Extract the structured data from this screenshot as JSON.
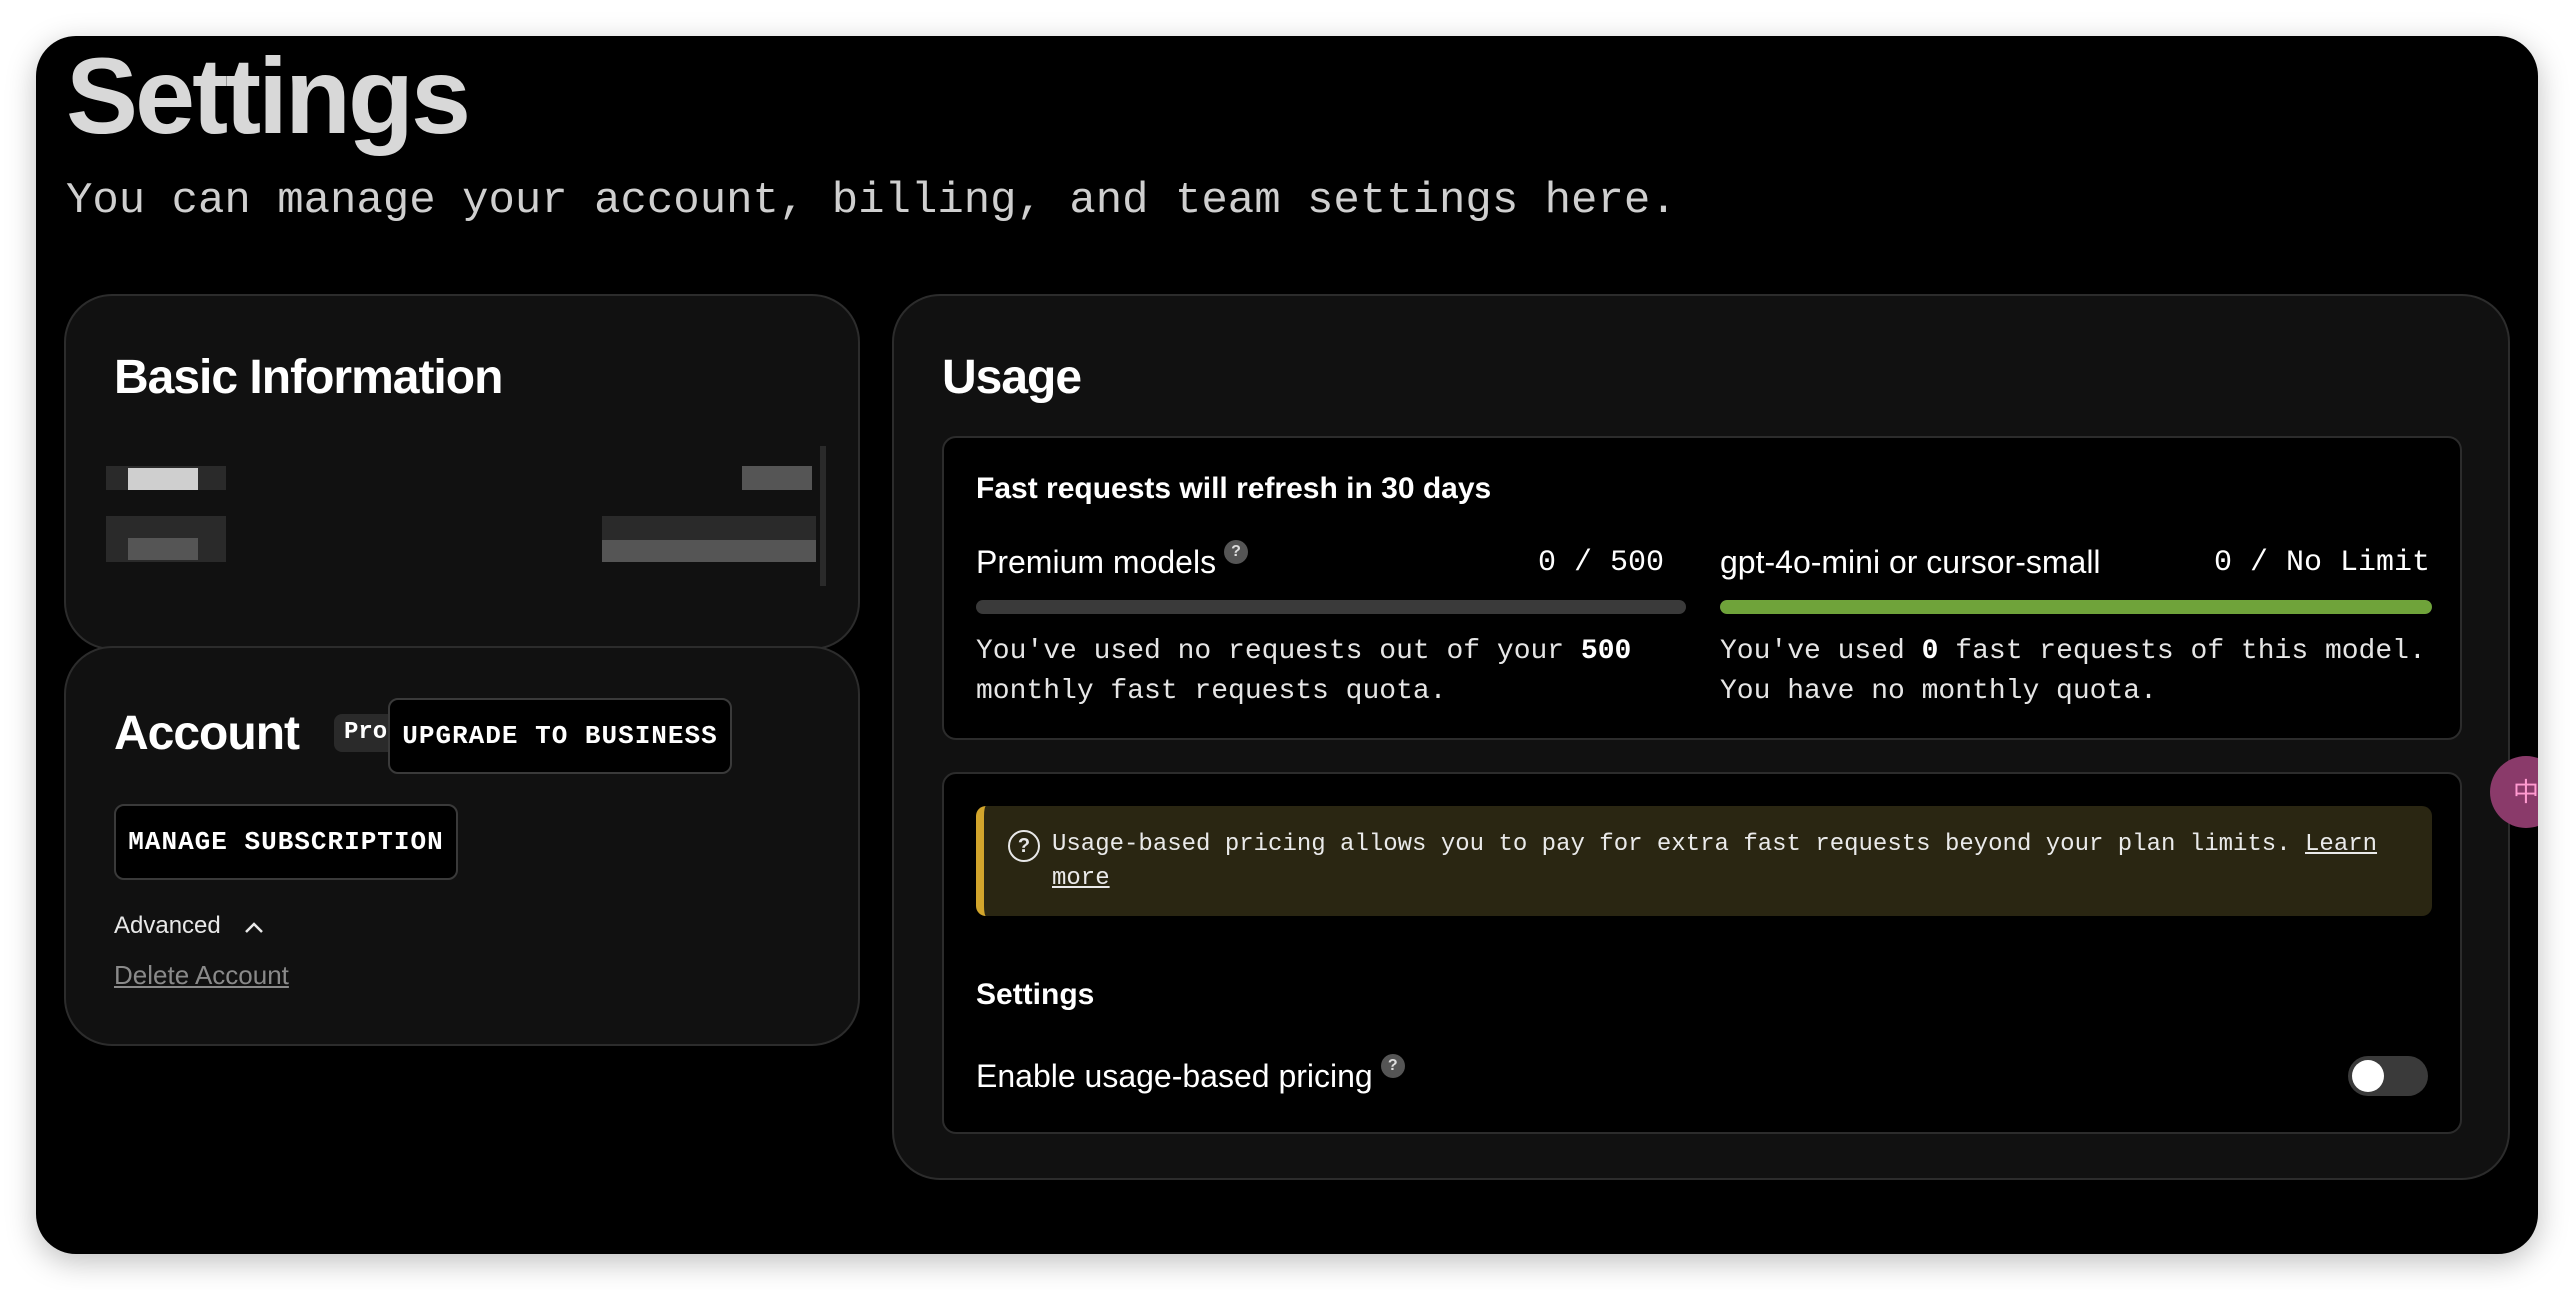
{
  "page": {
    "title": "Settings",
    "subtitle": "You can manage your account, billing, and team settings here."
  },
  "basic_info": {
    "title": "Basic Information"
  },
  "account": {
    "title": "Account",
    "plan_badge": "Pro",
    "upgrade_label": "UPGRADE TO BUSINESS",
    "manage_label": "MANAGE SUBSCRIPTION",
    "advanced_label": "Advanced",
    "delete_label": "Delete Account"
  },
  "usage": {
    "title": "Usage",
    "refresh_text": "Fast requests will refresh in 30 days",
    "premium": {
      "name": "Premium models",
      "count": "0 / 500",
      "fill": 0,
      "desc_pre": "You've used no requests out of your",
      "desc_bold": "500",
      "desc_post": "monthly fast requests quota."
    },
    "mini": {
      "name": "gpt-4o-mini or cursor-small",
      "count": "0 / No Limit",
      "fill": 1,
      "desc_pre": "You've used",
      "desc_bold": "0",
      "desc_post": "fast requests of this model. You have no monthly quota."
    },
    "notice_text": "Usage-based pricing allows you to pay for extra fast requests beyond your plan limits.",
    "notice_link": "Learn more",
    "settings_heading": "Settings",
    "pricing_label": "Enable usage-based pricing",
    "pricing_enabled": false
  },
  "colors": {
    "accent_green": "#6fa33a",
    "notice_border": "#d2a52c"
  }
}
